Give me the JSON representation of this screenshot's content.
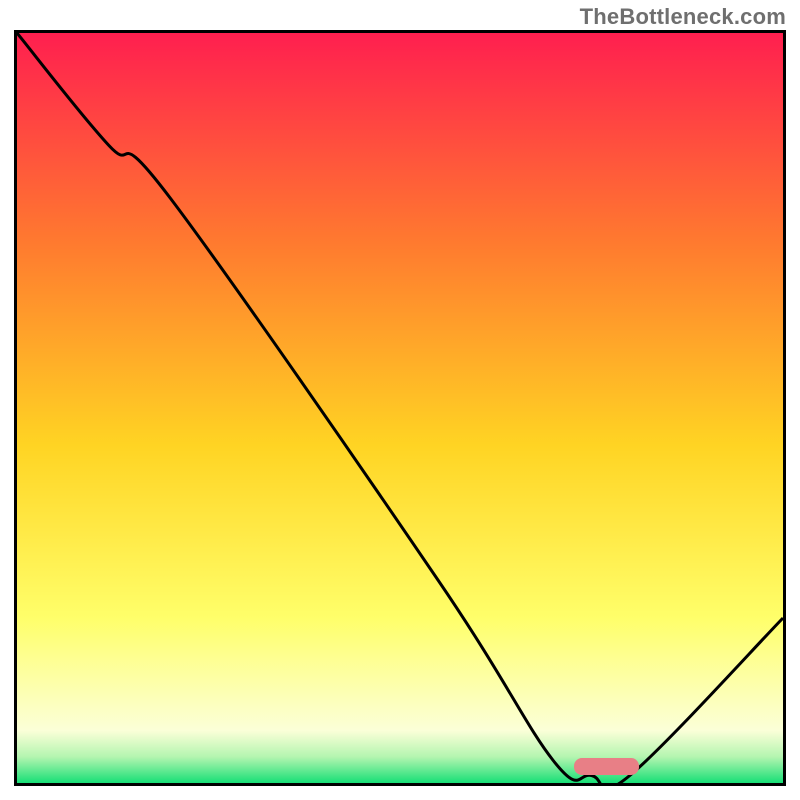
{
  "watermark": "TheBottleneck.com",
  "colors": {
    "top": "#ff1f4f",
    "mid_upper": "#ff8a2a",
    "mid": "#ffd820",
    "mid_lower": "#ffff66",
    "pale": "#fdffd6",
    "green": "#1ee07a",
    "marker": "#e87f86",
    "border": "#000000"
  },
  "chart_data": {
    "type": "line",
    "title": "",
    "xlabel": "",
    "ylabel": "",
    "xlim": [
      0,
      100
    ],
    "ylim": [
      0,
      100
    ],
    "series": [
      {
        "name": "curve",
        "x": [
          0,
          12,
          20,
          55,
          70,
          75,
          80,
          100
        ],
        "y": [
          100,
          85,
          78,
          27,
          3,
          1,
          1,
          22
        ]
      }
    ],
    "gradient_stops": [
      {
        "pos": 0.0,
        "color": "#ff1f4f"
      },
      {
        "pos": 0.28,
        "color": "#ff7a2f"
      },
      {
        "pos": 0.55,
        "color": "#ffd423"
      },
      {
        "pos": 0.78,
        "color": "#ffff6a"
      },
      {
        "pos": 0.93,
        "color": "#fbffd8"
      },
      {
        "pos": 0.965,
        "color": "#b4f5b0"
      },
      {
        "pos": 1.0,
        "color": "#17df76"
      }
    ],
    "marker": {
      "x_center": 77,
      "y": 2.2,
      "width": 8.5,
      "height": 2.2
    }
  }
}
